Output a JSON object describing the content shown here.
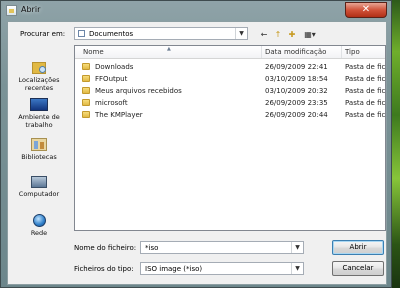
{
  "window": {
    "title": "Abrir",
    "close_glyph": "✕"
  },
  "toolbar": {
    "look_in_label": "Procurar em:",
    "look_in_value": "Documentos",
    "back_glyph": "←",
    "up_glyph": "↑",
    "new_folder_glyph": "✚",
    "views_glyph": "▦▾"
  },
  "places": [
    {
      "label_line1": "Localizações",
      "label_line2": "recentes",
      "icon": "recent-places-icon"
    },
    {
      "label_line1": "Ambiente de",
      "label_line2": "trabalho",
      "icon": "desktop-icon"
    },
    {
      "label_line1": "Bibliotecas",
      "label_line2": "",
      "icon": "libraries-icon"
    },
    {
      "label_line1": "Computador",
      "label_line2": "",
      "icon": "computer-icon"
    },
    {
      "label_line1": "Rede",
      "label_line2": "",
      "icon": "network-icon"
    }
  ],
  "file_list": {
    "columns": [
      "Nome",
      "Data modificação",
      "Tipo"
    ],
    "rows": [
      {
        "name": "Downloads",
        "date": "26/09/2009 22:41",
        "type": "Pasta de fich"
      },
      {
        "name": "FFOutput",
        "date": "03/10/2009 18:54",
        "type": "Pasta de fich"
      },
      {
        "name": "Meus arquivos recebidos",
        "date": "03/10/2009 20:32",
        "type": "Pasta de fich"
      },
      {
        "name": "microsoft",
        "date": "26/09/2009 23:35",
        "type": "Pasta de fich"
      },
      {
        "name": "The KMPlayer",
        "date": "26/09/2009 20:44",
        "type": "Pasta de fich"
      }
    ]
  },
  "filename": {
    "label": "Nome do ficheiro:",
    "value": "*iso"
  },
  "filetype": {
    "label": "Ficheiros do tipo:",
    "value": "ISO image (*iso)"
  },
  "buttons": {
    "open": "Abrir",
    "cancel": "Cancelar"
  },
  "colors": {
    "selection_accent": "#3c7fb1",
    "folder": "#e1b944",
    "close_button": "#d1533a"
  }
}
